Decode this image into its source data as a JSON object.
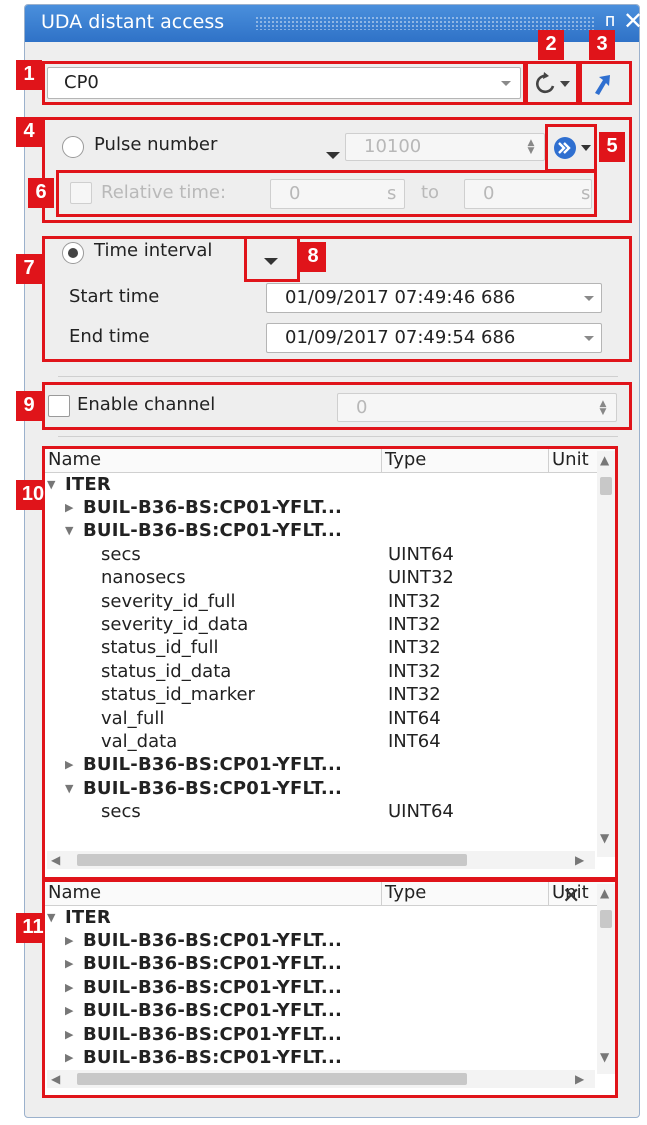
{
  "window": {
    "title": "UDA distant access",
    "pin_glyph": "ᴨ",
    "close_glyph": "✕"
  },
  "markers": [
    "1",
    "2",
    "3",
    "4",
    "5",
    "6",
    "7",
    "8",
    "9",
    "10",
    "11"
  ],
  "source": {
    "selected": "CP0"
  },
  "icons": {
    "refresh": "refresh-icon",
    "open": "open-arrow-icon",
    "go": "fast-forward-icon"
  },
  "pulse": {
    "label": "Pulse number",
    "value": "10100"
  },
  "relative": {
    "label": "Relative time:",
    "from": "0",
    "to_label": "to",
    "to": "0",
    "unit": "s"
  },
  "interval": {
    "label": "Time interval",
    "start_label": "Start time",
    "start_value": "01/09/2017 07:49:46 686",
    "end_label": "End time",
    "end_value": "01/09/2017 07:49:54 686"
  },
  "channel": {
    "label": "Enable channel",
    "value": "0"
  },
  "tree_columns": {
    "name": "Name",
    "type": "Type",
    "unit": "Unit"
  },
  "tree1": {
    "root": "ITER",
    "rows": [
      {
        "name": "BUIL-B36-BS:CP01-YFLT...",
        "type": "",
        "expanded": false
      },
      {
        "name": "BUIL-B36-BS:CP01-YFLT...",
        "type": "",
        "expanded": true
      },
      {
        "name": "secs",
        "type": "UINT64"
      },
      {
        "name": "nanosecs",
        "type": "UINT32"
      },
      {
        "name": "severity_id_full",
        "type": "INT32"
      },
      {
        "name": "severity_id_data",
        "type": "INT32"
      },
      {
        "name": "status_id_full",
        "type": "INT32"
      },
      {
        "name": "status_id_data",
        "type": "INT32"
      },
      {
        "name": "status_id_marker",
        "type": "INT32"
      },
      {
        "name": "val_full",
        "type": "INT64"
      },
      {
        "name": "val_data",
        "type": "INT64"
      },
      {
        "name": "BUIL-B36-BS:CP01-YFLT...",
        "type": "",
        "expanded": false
      },
      {
        "name": "BUIL-B36-BS:CP01-YFLT...",
        "type": "",
        "expanded": true
      },
      {
        "name": "secs",
        "type": "UINT64"
      }
    ]
  },
  "tree2": {
    "root": "ITER",
    "rows": [
      {
        "name": "BUIL-B36-BS:CP01-YFLT..."
      },
      {
        "name": "BUIL-B36-BS:CP01-YFLT..."
      },
      {
        "name": "BUIL-B36-BS:CP01-YFLT..."
      },
      {
        "name": "BUIL-B36-BS:CP01-YFLT..."
      },
      {
        "name": "BUIL-B36-BS:CP01-YFLT..."
      },
      {
        "name": "BUIL-B36-BS:CP01-YFLT..."
      }
    ]
  },
  "colors": {
    "title_bar": "#2f72c7",
    "marker": "#e0141a",
    "accent_icon": "#2f6fd0"
  }
}
